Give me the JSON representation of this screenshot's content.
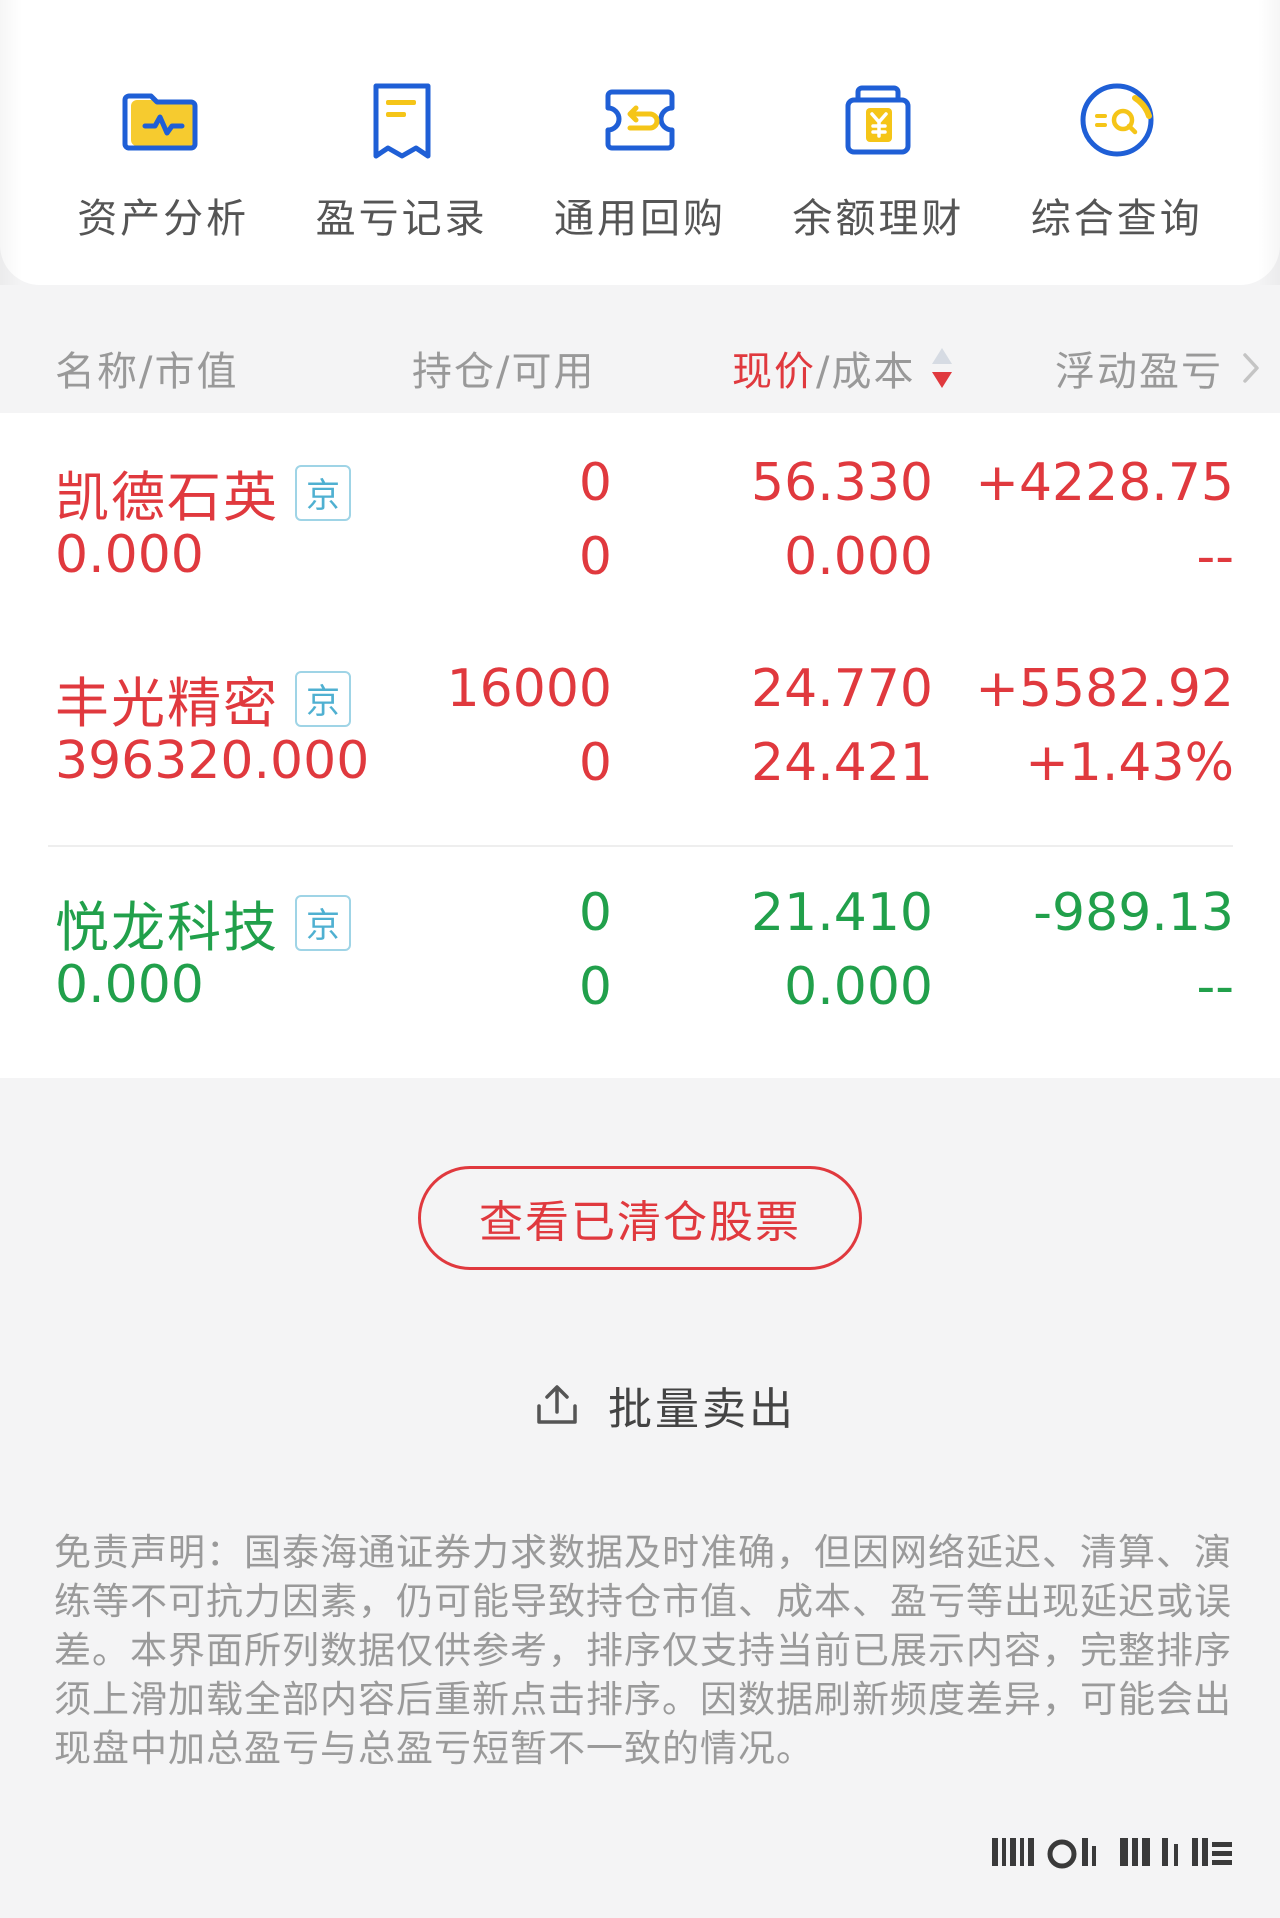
{
  "quick_menu": {
    "items": [
      {
        "label": "资产分析",
        "icon": "asset-analysis-icon"
      },
      {
        "label": "盈亏记录",
        "icon": "pnl-record-icon"
      },
      {
        "label": "通用回购",
        "icon": "repo-icon"
      },
      {
        "label": "余额理财",
        "icon": "balance-finance-icon"
      },
      {
        "label": "综合查询",
        "icon": "query-icon"
      }
    ]
  },
  "table": {
    "headers": {
      "name": "名称/市值",
      "hold": "持仓/可用",
      "price_active": "现价",
      "price_rest": "/成本",
      "pnl": "浮动盈亏"
    },
    "rows": [
      {
        "name": "凯德石英",
        "badge": "京",
        "market_value": "0.000",
        "holding": "0",
        "available": "0",
        "price": "56.330",
        "cost": "0.000",
        "pnl": "+4228.75",
        "pnl_pct": "--",
        "trend": "up"
      },
      {
        "name": "丰光精密",
        "badge": "京",
        "market_value": "396320.000",
        "holding": "16000",
        "available": "0",
        "price": "24.770",
        "cost": "24.421",
        "pnl": "+5582.92",
        "pnl_pct": "+1.43%",
        "trend": "up"
      },
      {
        "name": "悦龙科技",
        "badge": "京",
        "market_value": "0.000",
        "holding": "0",
        "available": "0",
        "price": "21.410",
        "cost": "0.000",
        "pnl": "-989.13",
        "pnl_pct": "--",
        "trend": "down"
      }
    ]
  },
  "actions": {
    "view_cleared": "查看已清仓股票",
    "batch_sell": "批量卖出"
  },
  "disclaimer": "免责声明：国泰海通证券力求数据及时准确，但因网络延迟、清算、演练等不可抗力因素，仍可能导致持仓市值、成本、盈亏等出现延迟或误差。本界面所列数据仅供参考，排序仅支持当前已展示内容，完整排序须上滑加载全部内容后重新点击排序。因数据刷新频度差异，可能会出现盘中加总盈亏与总盈亏短暂不一致的情况。",
  "colors": {
    "up": "#e0393e",
    "down": "#21a04b",
    "icon_blue": "#1f5fd6",
    "icon_yellow": "#f5c518"
  }
}
